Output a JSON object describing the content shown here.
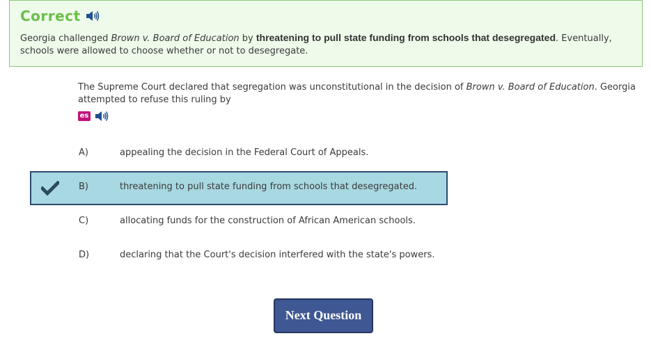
{
  "feedback": {
    "title": "Correct",
    "text_before": "Georgia challenged ",
    "case_name": "Brown v. Board of Education",
    "text_by": " by ",
    "bold_answer": "threatening to pull state funding from schools that desegregated",
    "text_after": ". Eventually, schools were allowed to choose whether or not to desegregate."
  },
  "question": {
    "text_before": "The Supreme Court declared that segregation was unconstitutional in the decision of ",
    "case_name": "Brown v. Board of Education",
    "text_after": ". Georgia attempted to refuse this ruling by",
    "translate_icon_label": "es"
  },
  "choices": [
    {
      "letter": "A)",
      "text": "appealing the decision in the Federal Court of Appeals.",
      "selected": false
    },
    {
      "letter": "B)",
      "text": "threatening to pull state funding from schools that desegregated.",
      "selected": true
    },
    {
      "letter": "C)",
      "text": "allocating funds for the construction of African American schools.",
      "selected": false
    },
    {
      "letter": "D)",
      "text": "declaring that the Court's decision interfered with the state's powers.",
      "selected": false
    }
  ],
  "next_button": {
    "label": "Next Question"
  },
  "colors": {
    "correct_green": "#6bbf4a",
    "feedback_bg": "#eefaea",
    "selected_bg": "#a8d8e2",
    "selected_border": "#2c4a6e",
    "button_bg": "#3f5793",
    "es_badge": "#c0147a",
    "speaker_blue": "#1f4f8f"
  },
  "icons": [
    "speaker-icon",
    "translate-es-icon",
    "checkmark-icon"
  ]
}
